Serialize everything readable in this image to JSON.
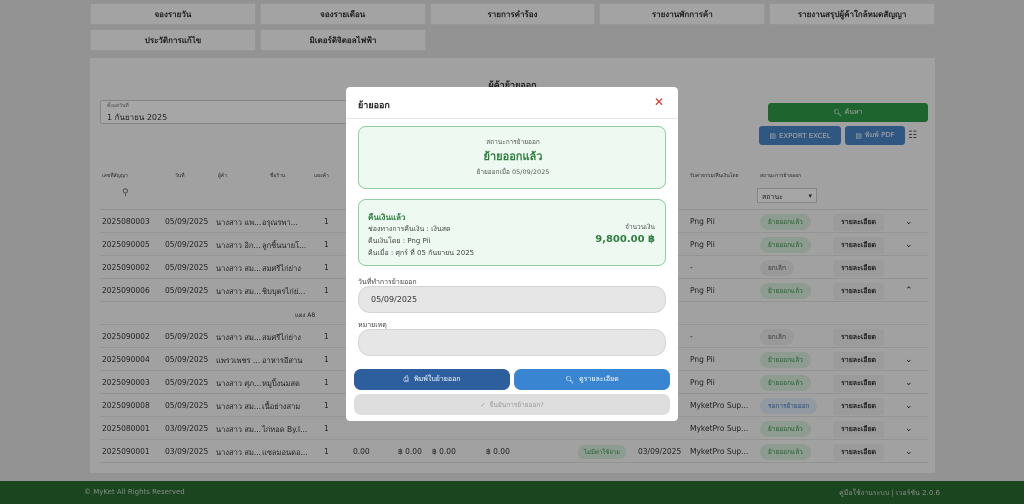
{
  "nav": {
    "row1": [
      "จองรายวัน",
      "จองรายเดือน",
      "รายการคำร้อง",
      "รายงานพักการค้า",
      "รายงานสรุปผู้ค้าใกล้หมดสัญญา"
    ],
    "row2": [
      "ประวัติการแก้ไข",
      "มิเตอร์ดิจิตอลไฟฟ้า"
    ]
  },
  "page": {
    "title": "ผู้ค้าย้ายออก",
    "date_label": "ตั้งแต่วันที่",
    "date_value": "1 กันยายน 2025",
    "search_label": "ค้นหา",
    "export_label": "EXPORT EXCEL",
    "pdf_label": "พิมพ์ PDF"
  },
  "table": {
    "headers": [
      "เลขที่สัญญา",
      "วันที่",
      "ผู้ค้า",
      "ชื่อร้าน",
      "แผงค้า",
      "รับค่าธรรม/คืนเงินโดย",
      "สถานะการย้ายออก"
    ],
    "status_placeholder": "สถานะ",
    "sub_row_label": "แผง A8",
    "rows": [
      {
        "contract": "2025080003",
        "date": "05/09/2025",
        "tenant": "นางสาว แพ...",
        "shop": "อรุณรพา...",
        "n": "1",
        "by": "Png Pii",
        "status": "ย้ายออกแล้ว",
        "detail": "รายละเอียด",
        "chev": "⌄"
      },
      {
        "contract": "2025090005",
        "date": "05/09/2025",
        "tenant": "นางสาว อิก...",
        "shop": "ลูกชิ้นนายโ...",
        "n": "1",
        "by": "Png Pii",
        "status": "ย้ายออกแล้ว",
        "detail": "รายละเอียด",
        "chev": "⌄"
      },
      {
        "contract": "2025090002",
        "date": "05/09/2025",
        "tenant": "นางสาว สม...",
        "shop": "สมศรีไก่ย่าง",
        "n": "1",
        "by": "-",
        "status": "ยกเลิก",
        "detail": "รายละเอียด",
        "chev": ""
      },
      {
        "contract": "2025090006",
        "date": "05/09/2025",
        "tenant": "นางสาว สม...",
        "shop": "ชิบบุตรไก่ย่...",
        "n": "1",
        "by": "Png Pii",
        "status": "ย้ายออกแล้ว",
        "detail": "รายละเอียด",
        "chev": "⌃"
      },
      {
        "contract": "2025090002",
        "date": "05/09/2025",
        "tenant": "นางสาว สม...",
        "shop": "สมศรีไก่ย่าง",
        "n": "1",
        "by": "-",
        "status": "ยกเลิก",
        "detail": "รายละเอียด",
        "chev": ""
      },
      {
        "contract": "2025090004",
        "date": "05/09/2025",
        "tenant": "แพรวเพชร ...",
        "shop": "อาหารอีสาน",
        "n": "1",
        "by": "Png Pii",
        "status": "ย้ายออกแล้ว",
        "detail": "รายละเอียด",
        "chev": "⌄"
      },
      {
        "contract": "2025090003",
        "date": "05/09/2025",
        "tenant": "นางสาว ศุภ...",
        "shop": "หมูปิ้งนมสด",
        "n": "1",
        "by": "Png Pii",
        "status": "ย้ายออกแล้ว",
        "detail": "รายละเอียด",
        "chev": "⌄"
      },
      {
        "contract": "2025090008",
        "date": "05/09/2025",
        "tenant": "นางสาว สม...",
        "shop": "เนื้อย่างสาม",
        "n": "1",
        "by": "MyketPro Sup...",
        "status": "รอการย้ายออก",
        "detail": "รายละเอียด",
        "chev": "⌄"
      },
      {
        "contract": "2025080001",
        "date": "03/09/2025",
        "tenant": "นางสาว สม...",
        "shop": "ไก่ทอด By.I...",
        "n": "1",
        "by": "MyketPro Sup...",
        "status": "ย้ายออกแล้ว",
        "detail": "รายละเอียด",
        "chev": "⌄"
      },
      {
        "contract": "2025090001",
        "date": "03/09/2025",
        "tenant": "นางสาว สม...",
        "shop": "แซลมอนดอ...",
        "n": "1",
        "m1": "0.00",
        "m2": "฿ 0.00",
        "m3": "฿ 0.00",
        "m4": "฿ 0.00",
        "pay": "ไม่มีค่าใช้จ่าย",
        "date2": "03/09/2025",
        "by": "MyketPro Sup...",
        "status": "ย้ายออกแล้ว",
        "detail": "รายละเอียด",
        "chev": "⌄"
      }
    ]
  },
  "footer": {
    "copyright": "© MyKet All Rights Reserved",
    "version": "คู่มือใช้งานระบบ | เวอร์ชัน 2.0.6"
  },
  "modal": {
    "title": "ย้ายออก",
    "status_label": "สถานะการย้ายออก",
    "status_value": "ย้ายออกแล้ว",
    "status_date": "ย้ายออกเมื่อ 05/09/2025",
    "refund_title": "คืนเงินแล้ว",
    "refund_channel": "ช่องทางการคืนเงิน : เงินสด",
    "refund_by": "คืนเงินโดย : Png Pii",
    "refund_when": "คืนเมื่อ : ศุกร์ ที่ 05 กันยายน 2025",
    "amount_label": "จำนวนเงิน",
    "amount_value": "9,800.00 ฿",
    "moveout_date_label": "วันที่ทำการย้ายออก",
    "moveout_date_value": "05/09/2025",
    "note_label": "หมายเหตุ",
    "note_value": "",
    "print_label": "พิมพ์ใบย้ายออก",
    "detail_label": "ดูรายละเอียด",
    "confirm_label": "ยืนยันการย้ายออก?"
  },
  "colors": {
    "accent": "#2f9a47",
    "footer": "#2a6b31",
    "primary": "#2d5f9e",
    "close": "#d33333"
  }
}
